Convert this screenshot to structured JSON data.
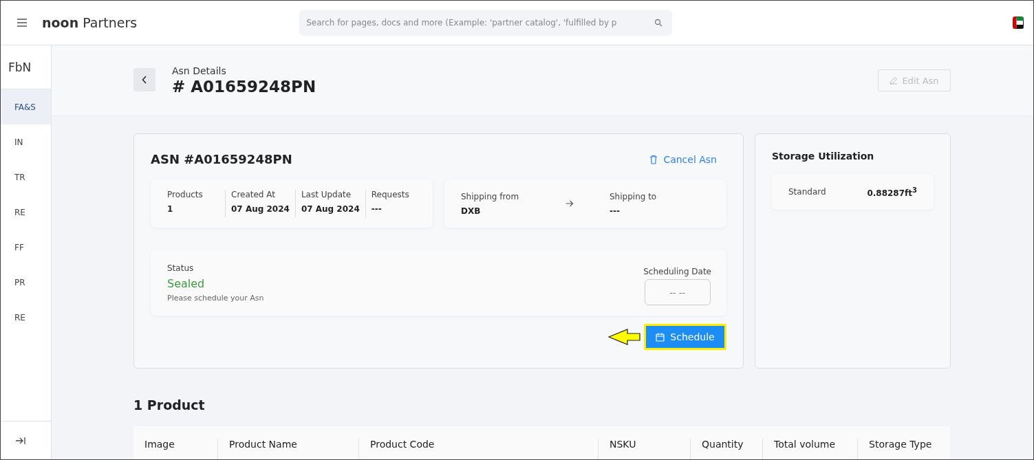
{
  "header": {
    "brand_bold": "noon",
    "brand_rest": "Partners",
    "search": {
      "placeholder": "Search for pages, docs and more (Example: 'partner catalog', 'fulfilled by p"
    }
  },
  "sidebar": {
    "title": "FbN",
    "items": [
      {
        "label": "FA&S",
        "selected": true
      },
      {
        "label": "IN",
        "selected": false
      },
      {
        "label": "TR",
        "selected": false
      },
      {
        "label": "RE",
        "selected": false
      },
      {
        "label": "FF",
        "selected": false
      },
      {
        "label": "PR",
        "selected": false
      },
      {
        "label": "RE",
        "selected": false
      }
    ]
  },
  "page_header": {
    "subtitle": "Asn Details",
    "title": "# A01659248PN",
    "edit_button": {
      "label": "Edit Asn",
      "disabled": true
    }
  },
  "asn_card": {
    "title": "ASN #A01659248PN",
    "cancel_link": "Cancel Asn",
    "info": [
      {
        "label": "Products",
        "value": "1"
      },
      {
        "label": "Created At",
        "value": "07 Aug 2024"
      },
      {
        "label": "Last Update",
        "value": "07 Aug 2024"
      },
      {
        "label": "Requests",
        "value": "---"
      }
    ],
    "shipping": {
      "from_label": "Shipping from",
      "from_value": "DXB",
      "to_label": "Shipping to",
      "to_value": "---"
    },
    "status": {
      "label": "Status",
      "value": "Sealed",
      "color": "#3d9a3d",
      "hint": "Please schedule your Asn",
      "date_label": "Scheduling Date",
      "date_value": "-- --"
    },
    "schedule_button": {
      "label": "Schedule",
      "highlighted": true
    }
  },
  "storage": {
    "title": "Storage Utilization",
    "rows": [
      {
        "label": "Standard",
        "value": "0.88287ft$^{3}$"
      }
    ]
  },
  "products": {
    "title": "1 Product",
    "columns": [
      "Image",
      "Product Name",
      "Product Code",
      "NSKU",
      "Quantity",
      "Total volume",
      "Storage Type"
    ]
  }
}
